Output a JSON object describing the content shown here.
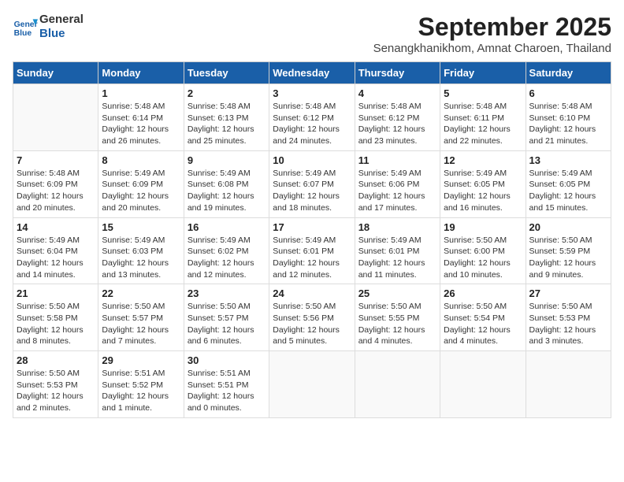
{
  "header": {
    "logo_line1": "General",
    "logo_line2": "Blue",
    "title": "September 2025",
    "subtitle": "Senangkhanikhom, Amnat Charoen, Thailand"
  },
  "days_of_week": [
    "Sunday",
    "Monday",
    "Tuesday",
    "Wednesday",
    "Thursday",
    "Friday",
    "Saturday"
  ],
  "weeks": [
    [
      {
        "day": "",
        "info": ""
      },
      {
        "day": "1",
        "info": "Sunrise: 5:48 AM\nSunset: 6:14 PM\nDaylight: 12 hours\nand 26 minutes."
      },
      {
        "day": "2",
        "info": "Sunrise: 5:48 AM\nSunset: 6:13 PM\nDaylight: 12 hours\nand 25 minutes."
      },
      {
        "day": "3",
        "info": "Sunrise: 5:48 AM\nSunset: 6:12 PM\nDaylight: 12 hours\nand 24 minutes."
      },
      {
        "day": "4",
        "info": "Sunrise: 5:48 AM\nSunset: 6:12 PM\nDaylight: 12 hours\nand 23 minutes."
      },
      {
        "day": "5",
        "info": "Sunrise: 5:48 AM\nSunset: 6:11 PM\nDaylight: 12 hours\nand 22 minutes."
      },
      {
        "day": "6",
        "info": "Sunrise: 5:48 AM\nSunset: 6:10 PM\nDaylight: 12 hours\nand 21 minutes."
      }
    ],
    [
      {
        "day": "7",
        "info": "Sunrise: 5:48 AM\nSunset: 6:09 PM\nDaylight: 12 hours\nand 20 minutes."
      },
      {
        "day": "8",
        "info": "Sunrise: 5:49 AM\nSunset: 6:09 PM\nDaylight: 12 hours\nand 20 minutes."
      },
      {
        "day": "9",
        "info": "Sunrise: 5:49 AM\nSunset: 6:08 PM\nDaylight: 12 hours\nand 19 minutes."
      },
      {
        "day": "10",
        "info": "Sunrise: 5:49 AM\nSunset: 6:07 PM\nDaylight: 12 hours\nand 18 minutes."
      },
      {
        "day": "11",
        "info": "Sunrise: 5:49 AM\nSunset: 6:06 PM\nDaylight: 12 hours\nand 17 minutes."
      },
      {
        "day": "12",
        "info": "Sunrise: 5:49 AM\nSunset: 6:05 PM\nDaylight: 12 hours\nand 16 minutes."
      },
      {
        "day": "13",
        "info": "Sunrise: 5:49 AM\nSunset: 6:05 PM\nDaylight: 12 hours\nand 15 minutes."
      }
    ],
    [
      {
        "day": "14",
        "info": "Sunrise: 5:49 AM\nSunset: 6:04 PM\nDaylight: 12 hours\nand 14 minutes."
      },
      {
        "day": "15",
        "info": "Sunrise: 5:49 AM\nSunset: 6:03 PM\nDaylight: 12 hours\nand 13 minutes."
      },
      {
        "day": "16",
        "info": "Sunrise: 5:49 AM\nSunset: 6:02 PM\nDaylight: 12 hours\nand 12 minutes."
      },
      {
        "day": "17",
        "info": "Sunrise: 5:49 AM\nSunset: 6:01 PM\nDaylight: 12 hours\nand 12 minutes."
      },
      {
        "day": "18",
        "info": "Sunrise: 5:49 AM\nSunset: 6:01 PM\nDaylight: 12 hours\nand 11 minutes."
      },
      {
        "day": "19",
        "info": "Sunrise: 5:50 AM\nSunset: 6:00 PM\nDaylight: 12 hours\nand 10 minutes."
      },
      {
        "day": "20",
        "info": "Sunrise: 5:50 AM\nSunset: 5:59 PM\nDaylight: 12 hours\nand 9 minutes."
      }
    ],
    [
      {
        "day": "21",
        "info": "Sunrise: 5:50 AM\nSunset: 5:58 PM\nDaylight: 12 hours\nand 8 minutes."
      },
      {
        "day": "22",
        "info": "Sunrise: 5:50 AM\nSunset: 5:57 PM\nDaylight: 12 hours\nand 7 minutes."
      },
      {
        "day": "23",
        "info": "Sunrise: 5:50 AM\nSunset: 5:57 PM\nDaylight: 12 hours\nand 6 minutes."
      },
      {
        "day": "24",
        "info": "Sunrise: 5:50 AM\nSunset: 5:56 PM\nDaylight: 12 hours\nand 5 minutes."
      },
      {
        "day": "25",
        "info": "Sunrise: 5:50 AM\nSunset: 5:55 PM\nDaylight: 12 hours\nand 4 minutes."
      },
      {
        "day": "26",
        "info": "Sunrise: 5:50 AM\nSunset: 5:54 PM\nDaylight: 12 hours\nand 4 minutes."
      },
      {
        "day": "27",
        "info": "Sunrise: 5:50 AM\nSunset: 5:53 PM\nDaylight: 12 hours\nand 3 minutes."
      }
    ],
    [
      {
        "day": "28",
        "info": "Sunrise: 5:50 AM\nSunset: 5:53 PM\nDaylight: 12 hours\nand 2 minutes."
      },
      {
        "day": "29",
        "info": "Sunrise: 5:51 AM\nSunset: 5:52 PM\nDaylight: 12 hours\nand 1 minute."
      },
      {
        "day": "30",
        "info": "Sunrise: 5:51 AM\nSunset: 5:51 PM\nDaylight: 12 hours\nand 0 minutes."
      },
      {
        "day": "",
        "info": ""
      },
      {
        "day": "",
        "info": ""
      },
      {
        "day": "",
        "info": ""
      },
      {
        "day": "",
        "info": ""
      }
    ]
  ]
}
